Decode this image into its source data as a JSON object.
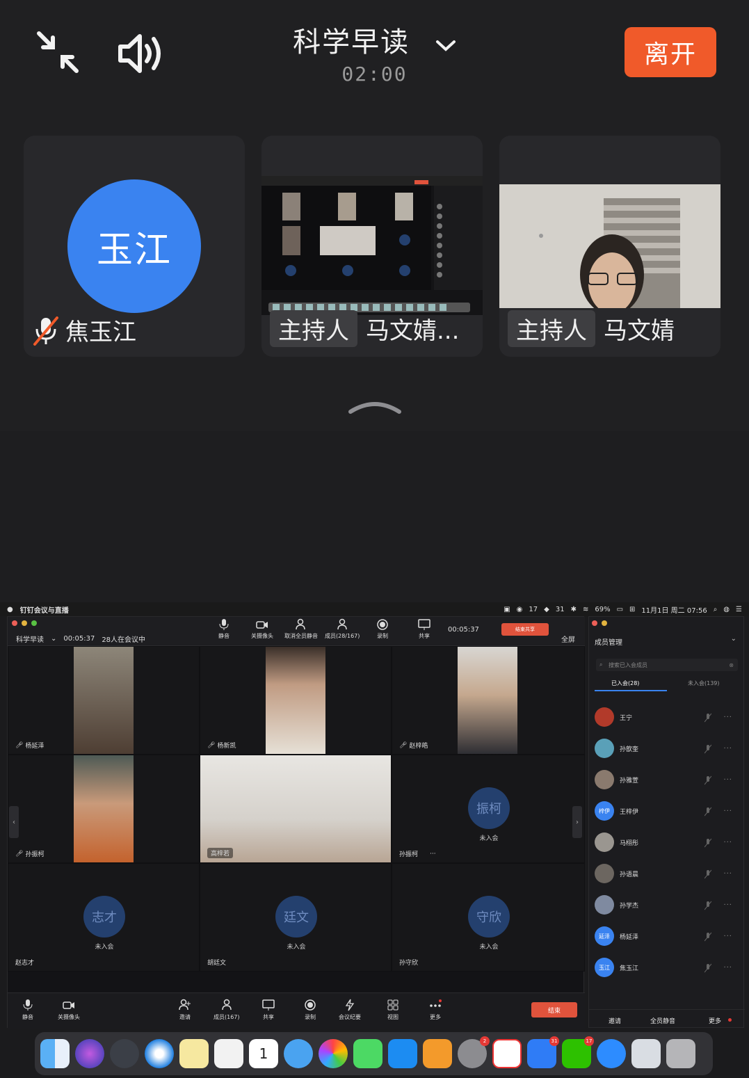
{
  "header": {
    "title": "科学早读",
    "timer": "02:00",
    "leave_label": "离开"
  },
  "tiles": [
    {
      "avatar_text": "玉江",
      "name": "焦玉江",
      "muted": true
    },
    {
      "host_tag": "主持人",
      "name": "马文婧..."
    },
    {
      "host_tag": "主持人",
      "name": "马文婧"
    }
  ],
  "menubar": {
    "app_name": "钉钉会议与直播",
    "wechat_count": "17",
    "dingtalk_count": "31",
    "battery": "69%",
    "datetime": "11月1日 周二  07:56"
  },
  "window": {
    "meeting_name": "科学早读",
    "elapsed": "00:05:37",
    "status": "28人在会议中",
    "toolbar": {
      "mute": "静音",
      "camera_off": "关摄像头",
      "unmute_all": "取消全员静音",
      "members": "成员(28/167)",
      "record": "录制",
      "share": "共享",
      "share_timer": "00:05:37",
      "stop_share": "结束共享",
      "fullscreen": "全屏"
    },
    "grid": [
      {
        "name": "杨延泽"
      },
      {
        "name": "杨新凯"
      },
      {
        "name": "赵梓皓"
      },
      {
        "name": "孙振柯"
      },
      {
        "name": "高梓若"
      },
      {
        "name": "孙振柯",
        "call_text": "振柯",
        "status": "未入会"
      },
      {
        "name": "赵志才",
        "call_text": "志才",
        "status": "未入会"
      },
      {
        "name": "胡廷文",
        "call_text": "廷文",
        "status": "未入会"
      },
      {
        "name": "孙守欣",
        "call_text": "守欣",
        "status": "未入会"
      }
    ],
    "bottombar": {
      "mute": "静音",
      "camera_off": "关摄像头",
      "invite": "邀请",
      "members": "成员(167)",
      "share": "共享",
      "record": "录制",
      "minutes": "会议纪要",
      "view": "视图",
      "more": "更多",
      "end": "结束"
    }
  },
  "members_panel": {
    "title": "成员管理",
    "search_placeholder": "搜索已入会成员",
    "tab_joined": "已入会(28)",
    "tab_not_joined": "未入会(139)",
    "members": [
      {
        "name": "王宁",
        "avatar": ""
      },
      {
        "name": "孙歆奎",
        "avatar": ""
      },
      {
        "name": "孙雅萱",
        "avatar": ""
      },
      {
        "name": "王梓伊",
        "avatar": "梓伊"
      },
      {
        "name": "马栩彤",
        "avatar": ""
      },
      {
        "name": "孙语晨",
        "avatar": ""
      },
      {
        "name": "孙学杰",
        "avatar": ""
      },
      {
        "name": "杨延泽",
        "avatar": "延泽"
      },
      {
        "name": "焦玉江",
        "avatar": "玉江"
      }
    ],
    "footer": {
      "invite": "邀请",
      "mute_all": "全员静音",
      "more": "更多"
    }
  },
  "dock": {
    "badges": {
      "settings": "2",
      "dingtalk": "31",
      "wechat": "17"
    }
  },
  "colors": {
    "leave": "#f05a2a",
    "avatar_blue": "#3a83f0",
    "end_red": "#e0533c"
  }
}
